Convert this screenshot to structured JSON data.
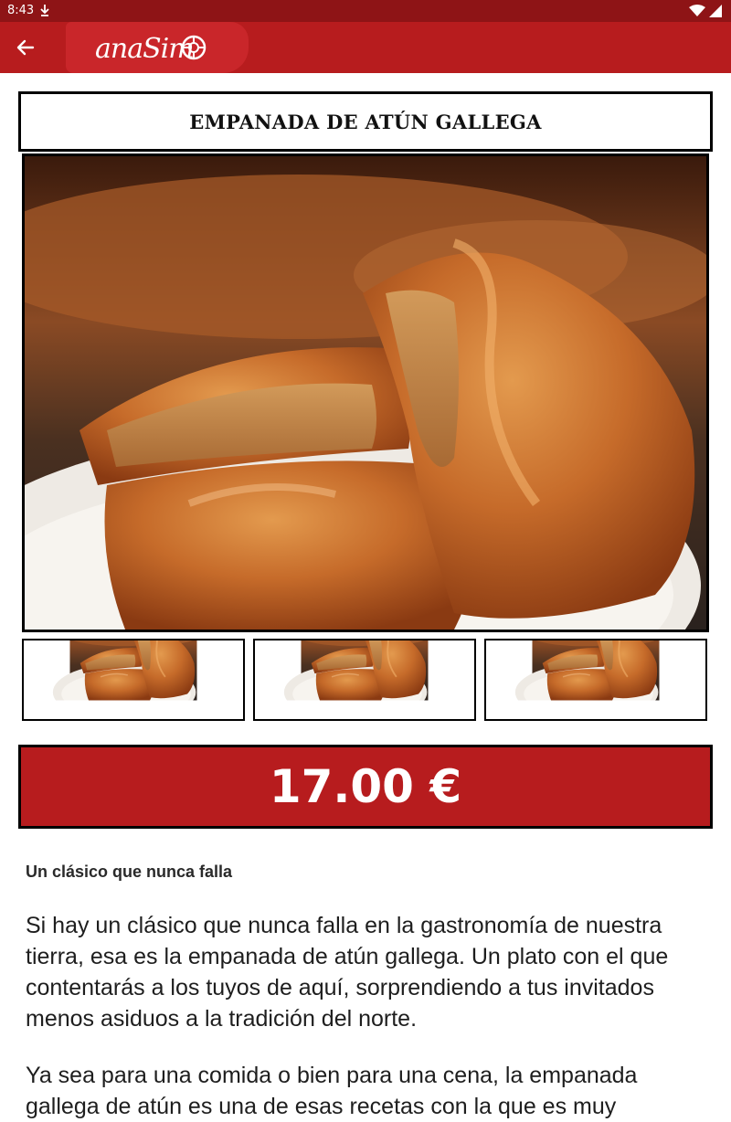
{
  "status_bar": {
    "time": "8:43"
  },
  "app_bar": {
    "logo_text": "anaSim"
  },
  "product": {
    "title": "EMPANADA DE ATÚN GALLEGA",
    "price": "17.00 €",
    "subtitle": "Un clásico que nunca falla",
    "paragraphs": [
      "Si hay un clásico que nunca falla en la gastronomía de nuestra tierra, esa es la empanada de atún gallega. Un plato con el que contentarás a los tuyos de aquí, sorprendiendo a tus invitados menos asiduos a la tradición del norte.",
      "Ya sea para una comida o bien para una cena, la empanada gallega de atún es una de esas recetas con la que es muy"
    ]
  },
  "colors": {
    "status_bar": "#8e1416",
    "app_bar": "#b71c1e",
    "price_bg": "#b71c1e"
  }
}
